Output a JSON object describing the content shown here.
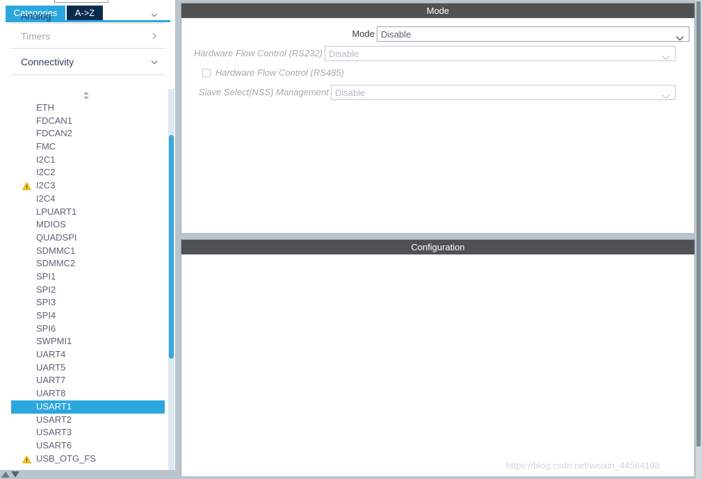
{
  "left_pane": {
    "search": {
      "value": "",
      "placeholder": ""
    },
    "tabs": [
      {
        "label": "Categories",
        "selected": true
      },
      {
        "label": "A->Z",
        "selected": false
      }
    ],
    "categories": [
      {
        "label": "Analog",
        "state": "active",
        "chevron": "chevron-down-icon"
      },
      {
        "label": "Timers",
        "state": "muted",
        "chevron": "chevron-right-icon"
      },
      {
        "label": "Connectivity",
        "state": "active",
        "chevron": "chevron-down-icon"
      }
    ],
    "device_list": [
      {
        "label": "ETH",
        "warning": false,
        "selected": false
      },
      {
        "label": "FDCAN1",
        "warning": false,
        "selected": false
      },
      {
        "label": "FDCAN2",
        "warning": false,
        "selected": false
      },
      {
        "label": "FMC",
        "warning": false,
        "selected": false
      },
      {
        "label": "I2C1",
        "warning": false,
        "selected": false
      },
      {
        "label": "I2C2",
        "warning": false,
        "selected": false
      },
      {
        "label": "I2C3",
        "warning": true,
        "selected": false
      },
      {
        "label": "I2C4",
        "warning": false,
        "selected": false
      },
      {
        "label": "LPUART1",
        "warning": false,
        "selected": false
      },
      {
        "label": "MDIOS",
        "warning": false,
        "selected": false
      },
      {
        "label": "QUADSPI",
        "warning": false,
        "selected": false
      },
      {
        "label": "SDMMC1",
        "warning": false,
        "selected": false
      },
      {
        "label": "SDMMC2",
        "warning": false,
        "selected": false
      },
      {
        "label": "SPI1",
        "warning": false,
        "selected": false
      },
      {
        "label": "SPI2",
        "warning": false,
        "selected": false
      },
      {
        "label": "SPI3",
        "warning": false,
        "selected": false
      },
      {
        "label": "SPI4",
        "warning": false,
        "selected": false
      },
      {
        "label": "SPI6",
        "warning": false,
        "selected": false
      },
      {
        "label": "SWPMI1",
        "warning": false,
        "selected": false
      },
      {
        "label": "UART4",
        "warning": false,
        "selected": false
      },
      {
        "label": "UART5",
        "warning": false,
        "selected": false
      },
      {
        "label": "UART7",
        "warning": false,
        "selected": false
      },
      {
        "label": "UART8",
        "warning": false,
        "selected": false
      },
      {
        "label": "USART1",
        "warning": false,
        "selected": true
      },
      {
        "label": "USART2",
        "warning": false,
        "selected": false
      },
      {
        "label": "USART3",
        "warning": false,
        "selected": false
      },
      {
        "label": "USART6",
        "warning": false,
        "selected": false
      },
      {
        "label": "USB_OTG_FS",
        "warning": true,
        "selected": false
      }
    ]
  },
  "mode_panel": {
    "title": "Mode",
    "fields": [
      {
        "label": "Mode",
        "value": "Disable",
        "control": "dropdown",
        "disabled": false
      },
      {
        "label": "Hardware Flow Control (RS232)",
        "value": "Disable",
        "control": "dropdown",
        "disabled": true
      },
      {
        "label": "Hardware Flow Control (RS485)",
        "value": "",
        "control": "checkbox",
        "checked": false,
        "disabled": true
      },
      {
        "label": "Slave Select(NSS) Management",
        "value": "Disable",
        "control": "dropdown",
        "disabled": true
      }
    ]
  },
  "config_panel": {
    "title": "Configuration"
  },
  "watermark": {
    "text": "https://blog.csdn.net/weixin_44584198"
  },
  "colors": {
    "accent_blue": "#2ca7de",
    "tab_dark": "#0a2b4e",
    "panel_header": "#4f5152",
    "window_bg": "#b9c4cc",
    "warning_yellow": "#f5c518",
    "selected_row": "#2ca7de"
  }
}
